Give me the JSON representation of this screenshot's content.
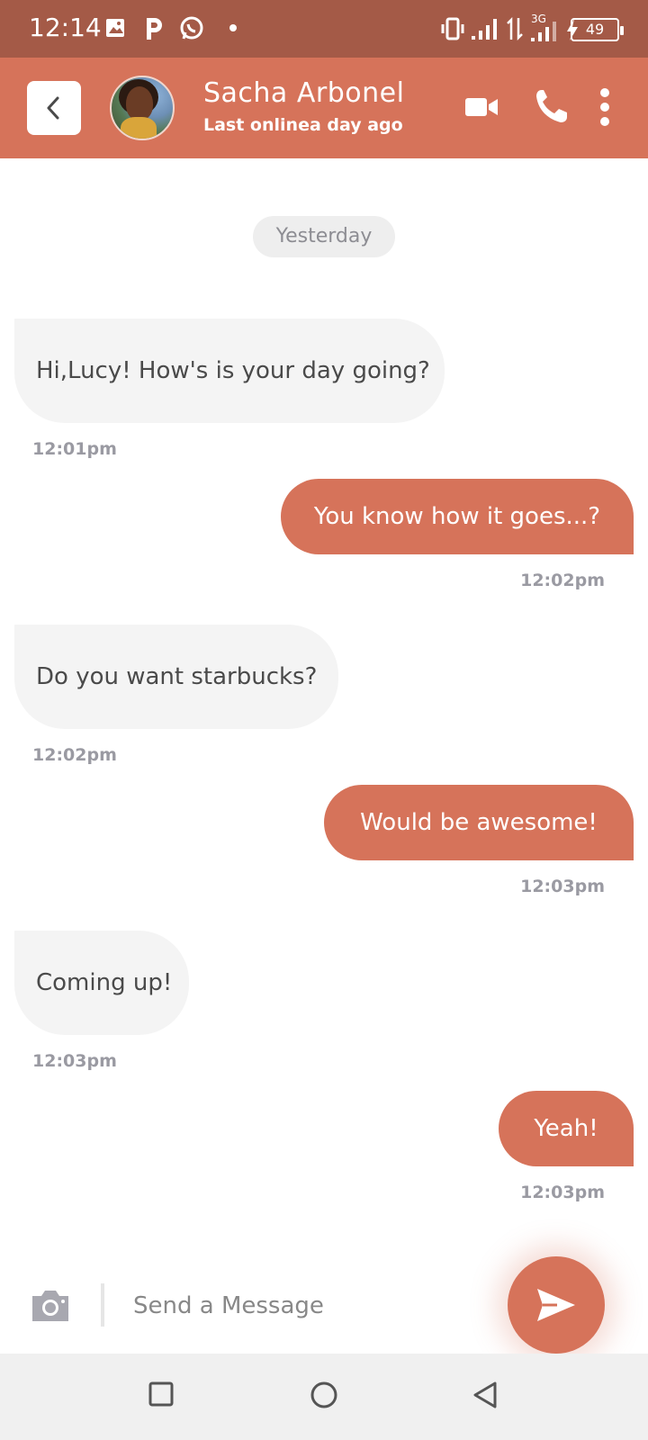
{
  "status_bar": {
    "time": "12:14",
    "battery": "49",
    "network": "3G"
  },
  "header": {
    "contact_name": "Sacha Arbonel",
    "last_online": "Last onlinea day ago",
    "accent_color": "#d6735a"
  },
  "chat": {
    "date_divider": "Yesterday",
    "messages": [
      {
        "direction": "in",
        "text": "Hi,Lucy! How's is your day going?",
        "time": "12:01pm"
      },
      {
        "direction": "out",
        "text": "You know how it goes...?",
        "time": "12:02pm"
      },
      {
        "direction": "in",
        "text": "Do you want starbucks?",
        "time": "12:02pm"
      },
      {
        "direction": "out",
        "text": "Would be awesome!",
        "time": "12:03pm"
      },
      {
        "direction": "in",
        "text": "Coming up!",
        "time": "12:03pm"
      },
      {
        "direction": "out",
        "text": "Yeah!",
        "time": "12:03pm"
      }
    ]
  },
  "composer": {
    "placeholder": "Send a Message",
    "value": ""
  },
  "icons": {
    "back": "chevron-left-icon",
    "video": "video-camera-icon",
    "call": "phone-icon",
    "more": "more-vertical-icon",
    "camera": "camera-icon",
    "send": "send-icon"
  }
}
